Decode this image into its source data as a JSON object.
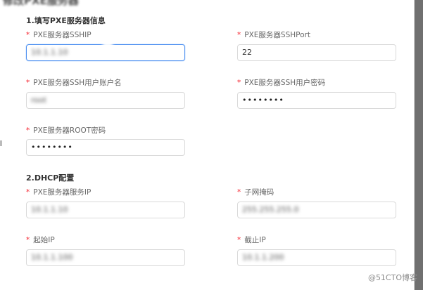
{
  "dialog": {
    "title": "修改PXE服务器"
  },
  "sections": {
    "pxe_info": {
      "title": "1.填写PXE服务器信息"
    },
    "dhcp": {
      "title": "2.DHCP配置"
    }
  },
  "fields": {
    "ssh_ip": {
      "label": "PXE服务器SSHIP",
      "value": "10.1.1.10"
    },
    "ssh_port": {
      "label": "PXE服务器SSHPort",
      "value": "22"
    },
    "ssh_user": {
      "label": "PXE服务器SSH用户账户名",
      "value": "root"
    },
    "ssh_password": {
      "label": "PXE服务器SSH用户密码",
      "value": "••••••••"
    },
    "root_password": {
      "label": "PXE服务器ROOT密码",
      "value": "••••••••"
    },
    "dhcp_server_ip": {
      "label": "PXE服务器服务IP",
      "value": "10.1.1.10"
    },
    "subnet_mask": {
      "label": "子网掩码",
      "value": "255.255.255.0"
    },
    "start_ip": {
      "label": "起始IP",
      "value": "10.1.1.100"
    },
    "end_ip": {
      "label": "截止IP",
      "value": "10.1.1.200"
    }
  },
  "required_mark": "*",
  "watermark": "@51CTO博客",
  "colors": {
    "required": "#f5222d",
    "focus_border": "#4c8ff0",
    "backdrop": "#707070"
  }
}
